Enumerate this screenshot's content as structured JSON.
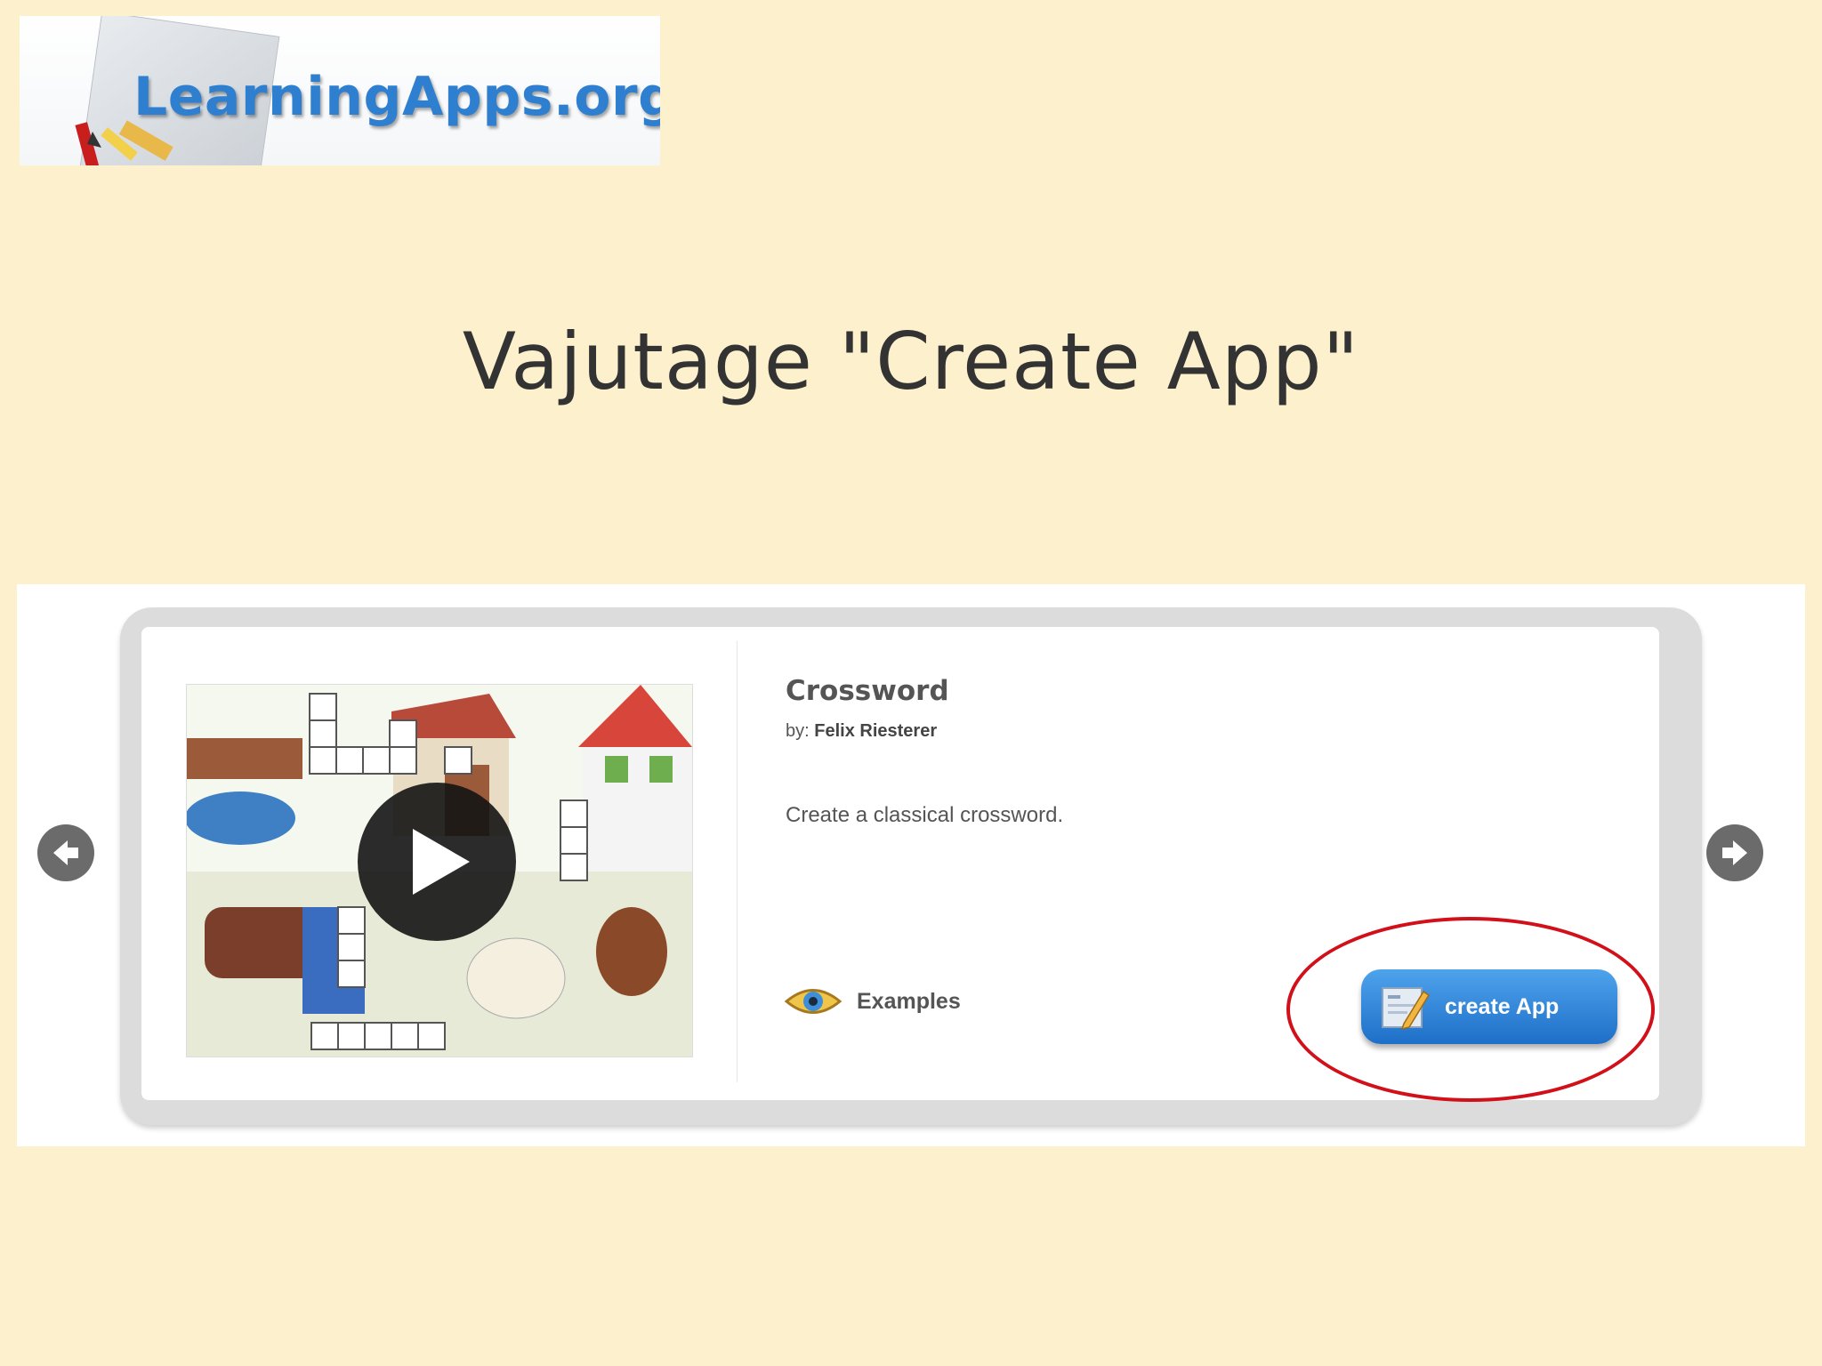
{
  "logo": {
    "text": "LearningApps.org",
    "color": "#2e7fd0"
  },
  "slide": {
    "headline": "Vajutage \"Create App\""
  },
  "app_card": {
    "title": "Crossword",
    "author_prefix": "by:",
    "author_name": "Felix Riesterer",
    "description": "Create a classical crossword.",
    "examples_label": "Examples",
    "create_button_label": "create App",
    "button_color": "#2f86dc"
  },
  "annotation": {
    "highlight_color": "#d2101a"
  },
  "icons": {
    "prev": "arrow-left-icon",
    "next": "arrow-right-icon",
    "play": "play-icon",
    "eye": "eye-icon",
    "create": "edit-document-icon"
  }
}
